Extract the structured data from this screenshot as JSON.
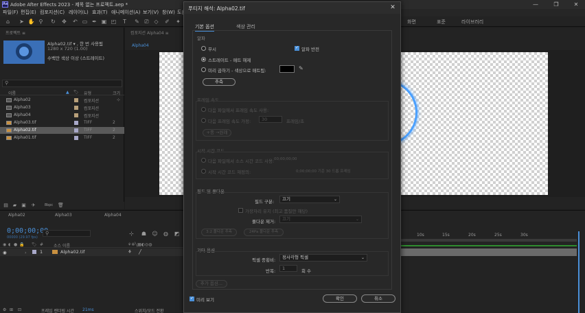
{
  "window": {
    "title": "Adobe After Effects 2023 - 제목 없는 프로젝트.aep *",
    "controls": [
      "—",
      "❐",
      "✕"
    ]
  },
  "menu": [
    "파일(F)",
    "편집(E)",
    "컴포지션(C)",
    "레이어(L)",
    "효과(T)",
    "애니메이션(A)",
    "보기(V)",
    "창(W)",
    "도움말(H)"
  ],
  "workspace_tabs": [
    "화면",
    "표준",
    "라이브러리"
  ],
  "project": {
    "panel_title": "프로젝트 ≡",
    "thumb_name": "Alpha02.tif ▾ , 한 번 사용됨",
    "thumb_dims": "1280 x 720 (1.00)",
    "thumb_color": "수백만 색상 이상 (스트레이트)",
    "columns": {
      "name": "이름",
      "label": "🏷",
      "type": "유형",
      "size": "크기"
    },
    "items": [
      {
        "name": "Alpha02",
        "type": "컴포지션",
        "size": "",
        "selected": false
      },
      {
        "name": "Alpha03",
        "type": "컴포지션",
        "size": "",
        "selected": false
      },
      {
        "name": "Alpha04",
        "type": "컴포지션",
        "size": "",
        "selected": false
      },
      {
        "name": "Alpha03.tif",
        "type": "TIFF",
        "size": "2",
        "selected": false
      },
      {
        "name": "Alpha02.tif",
        "type": "TIFF",
        "size": "2",
        "selected": true
      },
      {
        "name": "Alpha01.tif",
        "type": "TIFF",
        "size": "2",
        "selected": false
      }
    ],
    "bpc": "8bpc"
  },
  "comp": {
    "tab": "컴포지션 Alpha04 ≡",
    "subtab": "Alpha04"
  },
  "timeline": {
    "tabs": [
      "Alpha02",
      "Alpha03",
      "Alpha04"
    ],
    "timecode": "0;00;00;00",
    "timecode_sub": "00000 (29.97 fps)",
    "columns": {
      "layer": "소스 이름",
      "switches": "모드"
    },
    "layer": {
      "index": "1",
      "name": "Alpha02.tif"
    },
    "status_text": "프레임 렌더링 시간",
    "status_value": "21ms",
    "toggle_label": "스위치/모드 전환",
    "ruler": [
      "10s",
      "15s",
      "20s",
      "25s",
      "30s"
    ]
  },
  "dialog": {
    "title": "푸티지 해석: Alpha02.tif",
    "tabs": [
      "기본 옵션",
      "색상 관리"
    ],
    "alpha": {
      "section": "알파",
      "ignore": "무시",
      "invert": "알파 반전",
      "straight": "스트레이트 - 매트 해제",
      "premultiplied": "미리 곱하기 - 색상으로 매트됨:",
      "guess_button": "추측"
    },
    "framerate": {
      "section": "프레임 속도",
      "use_file": "다음 파일에서 프레임 속도 사용:",
      "assume": "다음 프레임 속도 가정:",
      "assume_value": "30",
      "fps_unit": "프레임/초",
      "remove_pulldown": "+종 →원래"
    },
    "timecode": {
      "section": "시작 시간 코드",
      "use_source": "다음 파일에서 소스 시간 코드 사용:",
      "source_value": "00;00;00;00",
      "override": "시작 시간 코드 재정의:",
      "override_info": "0;00;00;00  기준 30  드롭 프레임"
    },
    "fields": {
      "section": "필드 및 풀다운",
      "separate_label": "필드 구분:",
      "separate_value": "끄기",
      "preserve_edges": "가장자리 유지 (최고 품질만 해당)",
      "remove_pulldown_label": "풀다운 제거:",
      "remove_pulldown_value": "끄기",
      "guess_32": "3:2 풀다운 추측",
      "guess_24": "24Pa 풀다운 추측"
    },
    "other": {
      "section": "기타 옵션",
      "pixel_aspect_label": "픽셀 종횡비:",
      "pixel_aspect_value": "정사각형 픽셀",
      "loop_label": "반복:",
      "loop_value": "1",
      "loop_unit": "회 수",
      "more_button": "추가 옵션..."
    },
    "preview_label": "미리 보기",
    "ok_label": "확인",
    "cancel_label": "취소"
  },
  "colors": {
    "accent": "#4a90d9",
    "ring": "#4aa0ff"
  }
}
